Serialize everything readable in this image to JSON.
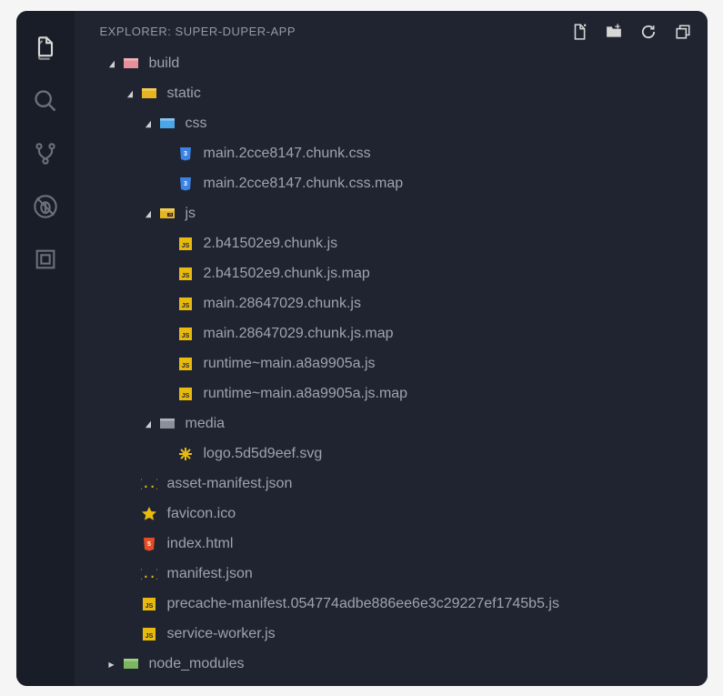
{
  "explorer": {
    "title": "EXPLORER: SUPER-DUPER-APP",
    "actions": {
      "new_file": "New File",
      "new_folder": "New Folder",
      "refresh": "Refresh",
      "collapse": "Collapse All"
    }
  },
  "tree": {
    "items": [
      {
        "name": "build",
        "type": "folder",
        "expanded": true,
        "icon": "folder-build",
        "indent": 1
      },
      {
        "name": "static",
        "type": "folder",
        "expanded": true,
        "icon": "folder-static",
        "indent": 2
      },
      {
        "name": "css",
        "type": "folder",
        "expanded": true,
        "icon": "folder-css",
        "indent": 3
      },
      {
        "name": "main.2cce8147.chunk.css",
        "type": "file",
        "icon": "file-css",
        "indent": 4
      },
      {
        "name": "main.2cce8147.chunk.css.map",
        "type": "file",
        "icon": "file-css",
        "indent": 4
      },
      {
        "name": "js",
        "type": "folder",
        "expanded": true,
        "icon": "folder-js",
        "indent": 3
      },
      {
        "name": "2.b41502e9.chunk.js",
        "type": "file",
        "icon": "file-js",
        "indent": 4
      },
      {
        "name": "2.b41502e9.chunk.js.map",
        "type": "file",
        "icon": "file-js",
        "indent": 4
      },
      {
        "name": "main.28647029.chunk.js",
        "type": "file",
        "icon": "file-js",
        "indent": 4
      },
      {
        "name": "main.28647029.chunk.js.map",
        "type": "file",
        "icon": "file-js",
        "indent": 4
      },
      {
        "name": "runtime~main.a8a9905a.js",
        "type": "file",
        "icon": "file-js",
        "indent": 4
      },
      {
        "name": "runtime~main.a8a9905a.js.map",
        "type": "file",
        "icon": "file-js",
        "indent": 4
      },
      {
        "name": "media",
        "type": "folder",
        "expanded": true,
        "icon": "folder-media",
        "indent": 3
      },
      {
        "name": "logo.5d5d9eef.svg",
        "type": "file",
        "icon": "file-svg",
        "indent": 4
      },
      {
        "name": "asset-manifest.json",
        "type": "file",
        "icon": "file-json",
        "indent": 2
      },
      {
        "name": "favicon.ico",
        "type": "file",
        "icon": "file-favicon",
        "indent": 2
      },
      {
        "name": "index.html",
        "type": "file",
        "icon": "file-html",
        "indent": 2
      },
      {
        "name": "manifest.json",
        "type": "file",
        "icon": "file-json",
        "indent": 2
      },
      {
        "name": "precache-manifest.054774adbe886ee6e3c29227ef1745b5.js",
        "type": "file",
        "icon": "file-js",
        "indent": 2
      },
      {
        "name": "service-worker.js",
        "type": "file",
        "icon": "file-js",
        "indent": 2
      },
      {
        "name": "node_modules",
        "type": "folder",
        "expanded": false,
        "icon": "folder-node",
        "indent": 1
      }
    ]
  }
}
